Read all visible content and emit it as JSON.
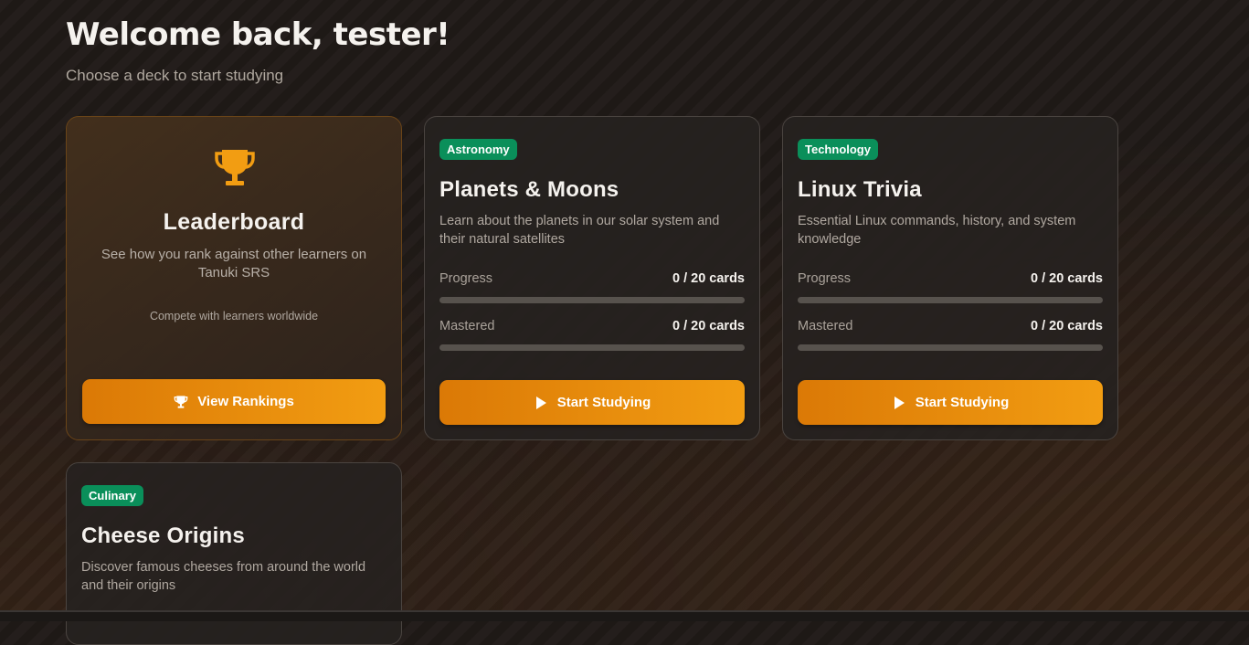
{
  "header": {
    "welcome": "Welcome back, tester!",
    "subtitle": "Choose a deck to start studying"
  },
  "leaderboard": {
    "icon": "trophy-icon",
    "title": "Leaderboard",
    "description": "See how you rank against other learners on Tanuki SRS",
    "note": "Compete with learners worldwide",
    "button_label": "View Rankings"
  },
  "decks": [
    {
      "category": "Astronomy",
      "title": "Planets & Moons",
      "description": "Learn about the planets in our solar system and their natural satellites",
      "progress_label": "Progress",
      "progress_value": "0 / 20 cards",
      "progress_fraction": 0,
      "mastered_label": "Mastered",
      "mastered_value": "0 / 20 cards",
      "mastered_fraction": 0,
      "button_label": "Start Studying"
    },
    {
      "category": "Technology",
      "title": "Linux Trivia",
      "description": "Essential Linux commands, history, and system knowledge",
      "progress_label": "Progress",
      "progress_value": "0 / 20 cards",
      "progress_fraction": 0,
      "mastered_label": "Mastered",
      "mastered_value": "0 / 20 cards",
      "mastered_fraction": 0,
      "button_label": "Start Studying"
    },
    {
      "category": "Culinary",
      "title": "Cheese Origins",
      "description": "Discover famous cheeses from around the world and their origins"
    }
  ],
  "colors": {
    "accent": "#f29d12",
    "badge": "#0a8f5a",
    "background": "#201a17"
  }
}
